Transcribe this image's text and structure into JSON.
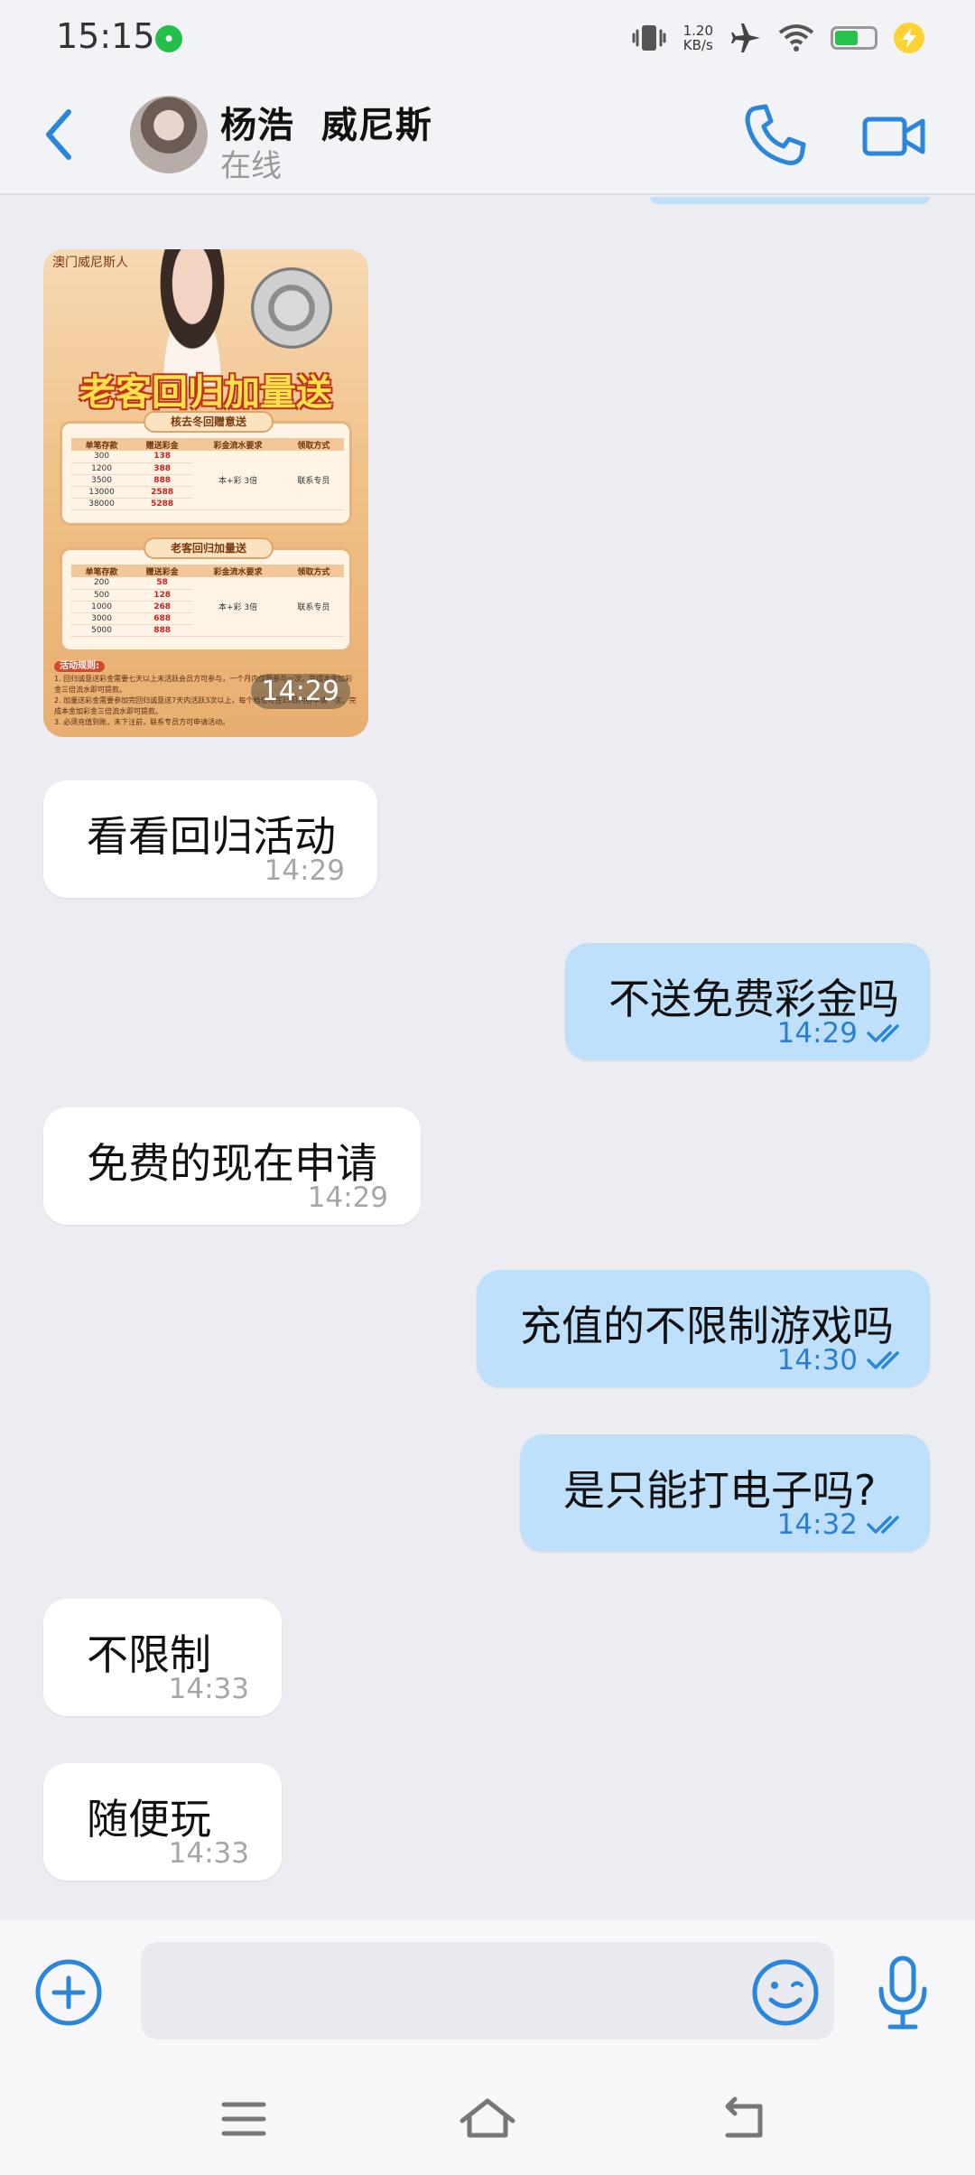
{
  "status_bar": {
    "time": "15:15",
    "network_speed_value": "1.20",
    "network_speed_unit": "KB/s",
    "battery_level": 0.55
  },
  "header": {
    "contact_name": "杨浩  威尼斯",
    "contact_status": "在线"
  },
  "promo_image": {
    "brand": "澳门威尼斯人",
    "title": "老客回归加量送",
    "time": "14:29",
    "table1_title": "核去冬回赠意送",
    "table2_title": "老客回归加量送",
    "columns": [
      "单笔存款",
      "赠送彩金",
      "彩金流水要求",
      "领取方式"
    ],
    "table1_rows": [
      [
        "300",
        "138"
      ],
      [
        "1200",
        "388"
      ],
      [
        "3500",
        "888"
      ],
      [
        "13000",
        "2588"
      ],
      [
        "38000",
        "5288"
      ]
    ],
    "table2_rows": [
      [
        "200",
        "58"
      ],
      [
        "500",
        "128"
      ],
      [
        "1000",
        "268"
      ],
      [
        "3000",
        "688"
      ],
      [
        "5000",
        "888"
      ]
    ],
    "requirement": "本+彩 3倍",
    "claim_method": "联系专员",
    "rules_title": "活动规则:",
    "rules": [
      "1. 回归诚意送彩金需要七天以上未活跃会员方可参与，一个月内仅限参与一次。完成本金加彩金三倍流水即可提款。",
      "2. 加量送彩金需要参加完回归诚意送7天内活跃3次以上，每个档位可在15日内各申请一次，完成本金加彩金三倍流水即可提款。",
      "3. 必须充值到账，未下注前，联系专员方可申请活动。"
    ]
  },
  "messages": [
    {
      "direction": "in",
      "text": "看看回归活动",
      "time": "14:29"
    },
    {
      "direction": "out",
      "text": "不送免费彩金吗",
      "time": "14:29"
    },
    {
      "direction": "in",
      "text": "免费的现在申请",
      "time": "14:29"
    },
    {
      "direction": "out",
      "text": "充值的不限制游戏吗",
      "time": "14:30"
    },
    {
      "direction": "out",
      "text": "是只能打电子吗?",
      "time": "14:32"
    },
    {
      "direction": "in",
      "text": "不限制",
      "time": "14:33"
    },
    {
      "direction": "in",
      "text": "随便玩",
      "time": "14:33"
    }
  ],
  "input": {
    "placeholder": "",
    "value": ""
  },
  "colors": {
    "accent": "#2a86db",
    "outgoing_bubble": "#bfe0fb",
    "incoming_bubble": "#ffffff",
    "background": "#ecedf3"
  }
}
